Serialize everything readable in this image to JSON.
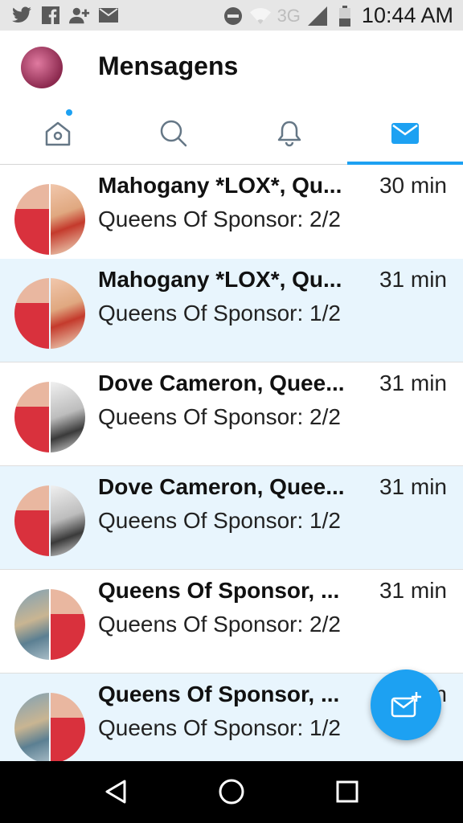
{
  "statusbar": {
    "network": "3G",
    "time": "10:44 AM",
    "icons": [
      "twitter-icon",
      "facebook-icon",
      "add-contact-icon",
      "mail-icon",
      "do-not-disturb-icon",
      "wifi-icon",
      "signal-icon",
      "battery-icon"
    ]
  },
  "header": {
    "title": "Mensagens"
  },
  "tabs": [
    {
      "name": "home",
      "icon": "home-icon",
      "has_dot": true,
      "active": false
    },
    {
      "name": "search",
      "icon": "search-icon",
      "active": false
    },
    {
      "name": "notifications",
      "icon": "bell-icon",
      "active": false
    },
    {
      "name": "messages",
      "icon": "mail-icon",
      "active": true
    }
  ],
  "conversations": [
    {
      "title": "Mahogany *LOX*, Qu...",
      "time": "30 min",
      "preview": "Queens Of Sponsor: 2/2",
      "highlighted": false,
      "avatars": [
        "man",
        "red"
      ]
    },
    {
      "title": "Mahogany *LOX*, Qu...",
      "time": "31 min",
      "preview": "Queens Of Sponsor: 1/2",
      "highlighted": true,
      "avatars": [
        "man",
        "red"
      ]
    },
    {
      "title": "Dove Cameron, Quee...",
      "time": "31 min",
      "preview": "Queens Of Sponsor: 2/2",
      "highlighted": false,
      "avatars": [
        "man",
        "bw"
      ]
    },
    {
      "title": "Dove Cameron, Quee...",
      "time": "31 min",
      "preview": "Queens Of Sponsor: 1/2",
      "highlighted": true,
      "avatars": [
        "man",
        "bw"
      ]
    },
    {
      "title": "Queens Of Sponsor, ...",
      "time": "31 min",
      "preview": "Queens Of Sponsor: 2/2",
      "highlighted": false,
      "avatars": [
        "map",
        "man"
      ]
    },
    {
      "title": "Queens Of Sponsor, ...",
      "time": "31 min",
      "preview": "Queens Of Sponsor: 1/2",
      "highlighted": true,
      "avatars": [
        "map",
        "man"
      ]
    }
  ],
  "fab": {
    "icon": "new-message-icon"
  },
  "navbar": {
    "icons": [
      "back-icon",
      "home-icon",
      "recents-icon"
    ]
  },
  "colors": {
    "accent": "#1da1f2",
    "highlight_row": "#e8f5fd",
    "statusbar_bg": "#e6e6e6",
    "navbar_bg": "#000000"
  }
}
